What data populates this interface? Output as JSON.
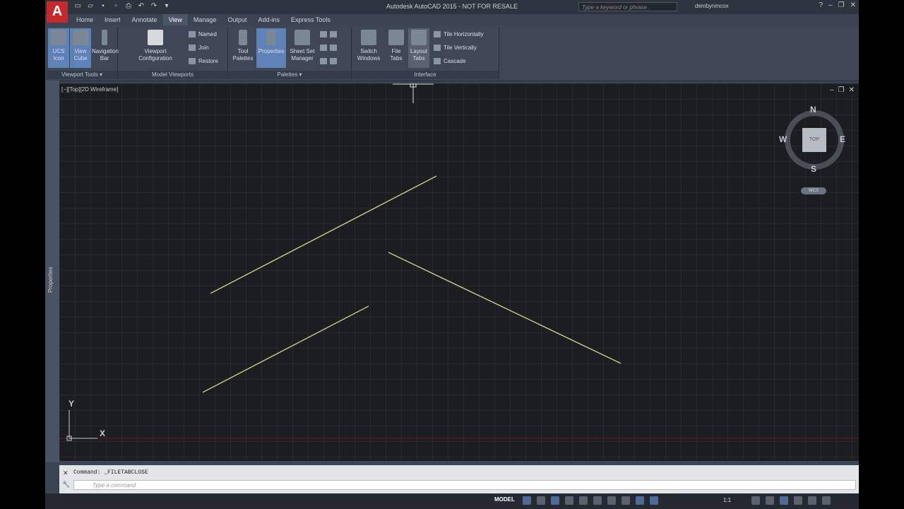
{
  "window": {
    "title": "Autodesk AutoCAD 2015 - NOT FOR RESALE",
    "search_placeholder": "Type a keyword or phrase",
    "user": "dembynmcox",
    "logo_letter": "A"
  },
  "tabs": [
    "Home",
    "Insert",
    "Annotate",
    "View",
    "Manage",
    "Output",
    "Add-ins",
    "Express Tools"
  ],
  "active_tab": "View",
  "ribbon": {
    "viewport_tools": {
      "label": "Viewport Tools ▾",
      "ucs_icon": "UCS Icon",
      "view_cube": "View Cube",
      "navigation_bar": "Navigation Bar"
    },
    "model_viewports": {
      "label": "Model Viewports",
      "viewport_configuration": "Viewport Configuration",
      "named": "Named",
      "join": "Join",
      "restore": "Restore"
    },
    "palettes": {
      "label": "Palettes ▾",
      "tool_palettes": "Tool Palettes",
      "properties": "Properties",
      "sheet_set_manager": "Sheet Set Manager"
    },
    "interface": {
      "label": "Interface",
      "switch_windows": "Switch Windows",
      "file_tabs": "File Tabs",
      "layout_tabs": "Layout Tabs",
      "tile_horizontally": "Tile Horizontally",
      "tile_vertically": "Tile Vertically",
      "cascade": "Cascade"
    }
  },
  "left_palette_label": "Properties",
  "viewport": {
    "label": "[−][Top][2D Wireframe]",
    "compass": {
      "n": "N",
      "s": "S",
      "e": "E",
      "w": "W",
      "top": "TOP"
    },
    "wcs": "WCS",
    "ucs_y": "Y",
    "ucs_x": "X"
  },
  "command": {
    "history": "Command: _FILETABCLOSE",
    "placeholder": "Type a command"
  },
  "status": {
    "model": "MODEL",
    "scale": "1:1"
  },
  "colors": {
    "line": "#c9c98e",
    "accent": "#5c82b8",
    "axis_red": "#7a1c1c"
  }
}
